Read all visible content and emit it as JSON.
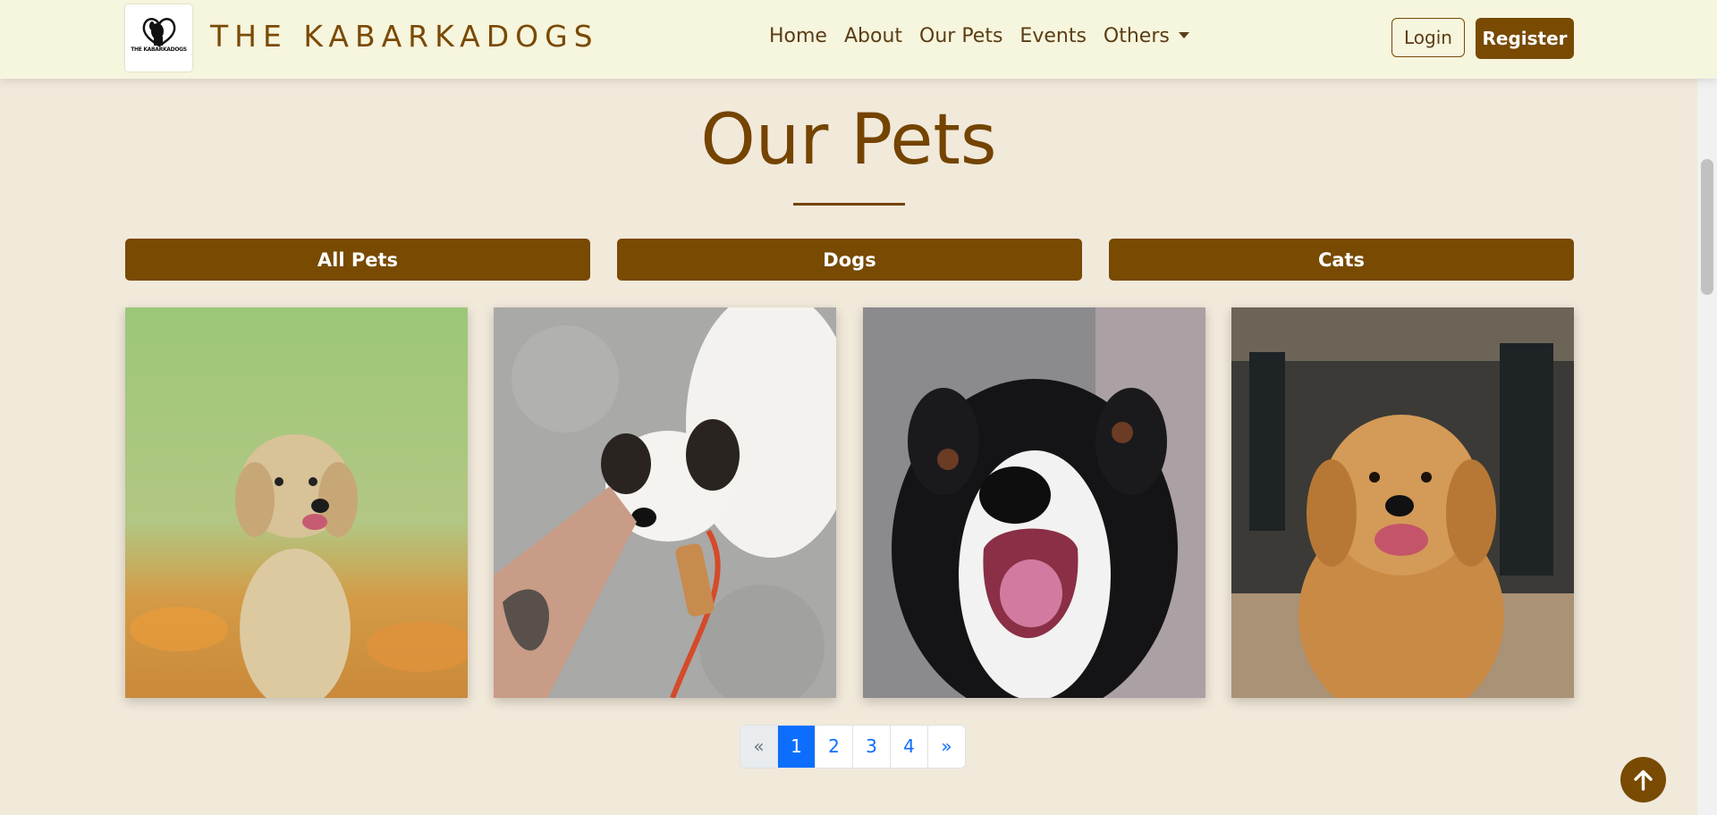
{
  "header": {
    "brand": "THE KABARKADOGS",
    "logo_text": "THE KABARKADOGS",
    "nav": [
      "Home",
      "About",
      "Our Pets",
      "Events",
      "Others"
    ],
    "login_label": "Login",
    "register_label": "Register"
  },
  "main": {
    "title": "Our Pets",
    "filters": [
      "All Pets",
      "Dogs",
      "Cats"
    ],
    "pagination": {
      "prev": "«",
      "pages": [
        "1",
        "2",
        "3",
        "4"
      ],
      "next": "»",
      "active": "1"
    }
  },
  "colors": {
    "brand_brown": "#784a02",
    "navbar_bg": "#f6f5dd",
    "page_bg": "#f1e9da",
    "active_page": "#0d6efd"
  }
}
